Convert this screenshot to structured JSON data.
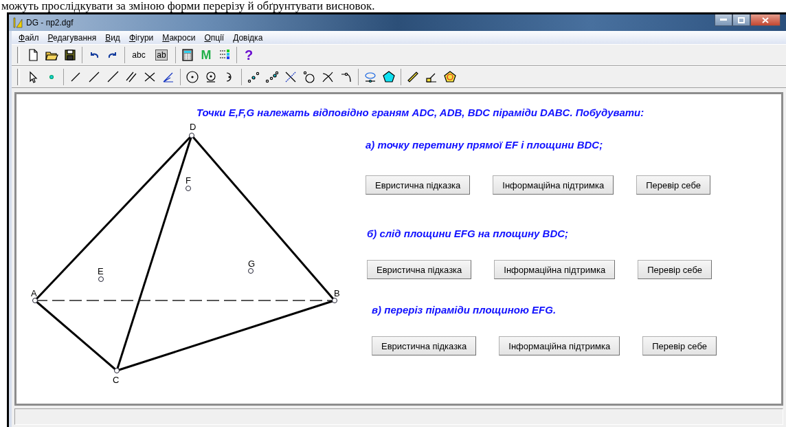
{
  "document_text": "можуть прослідкувати за зміною форми перерізу й обґрунтувати висновок.",
  "window": {
    "title": "DG - пр2.dgf"
  },
  "menu": [
    "Файл",
    "Редагування",
    "Вид",
    "Фігури",
    "Макроси",
    "Опції",
    "Довідка"
  ],
  "toolbar": {
    "text_tool": "abc",
    "label_tool": "ab",
    "macro_tool": "M",
    "help_tool": "?"
  },
  "canvas": {
    "heading": "Точки E,F,G належать відповідно граням ADC, ADB, BDC піраміди DABC. Побудувати:",
    "points": [
      {
        "label": "A"
      },
      {
        "label": "B"
      },
      {
        "label": "C"
      },
      {
        "label": "D"
      },
      {
        "label": "E"
      },
      {
        "label": "F"
      },
      {
        "label": "G"
      }
    ],
    "tasks": [
      {
        "text": "а) точку перетину прямої EF і площини BDC;",
        "buttons": [
          "Евристична підказка",
          "Інформаційна підтримка",
          "Перевір себе"
        ]
      },
      {
        "text": "б) слід площини EFG на площину BDC;",
        "buttons": [
          "Евристична підказка",
          "Інформаційна підтримка",
          "Перевір себе"
        ]
      },
      {
        "text": "в) переріз піраміди площиною EFG.",
        "buttons": [
          "Евристична підказка",
          "Інформаційна підтримка",
          "Перевір себе"
        ]
      }
    ]
  }
}
